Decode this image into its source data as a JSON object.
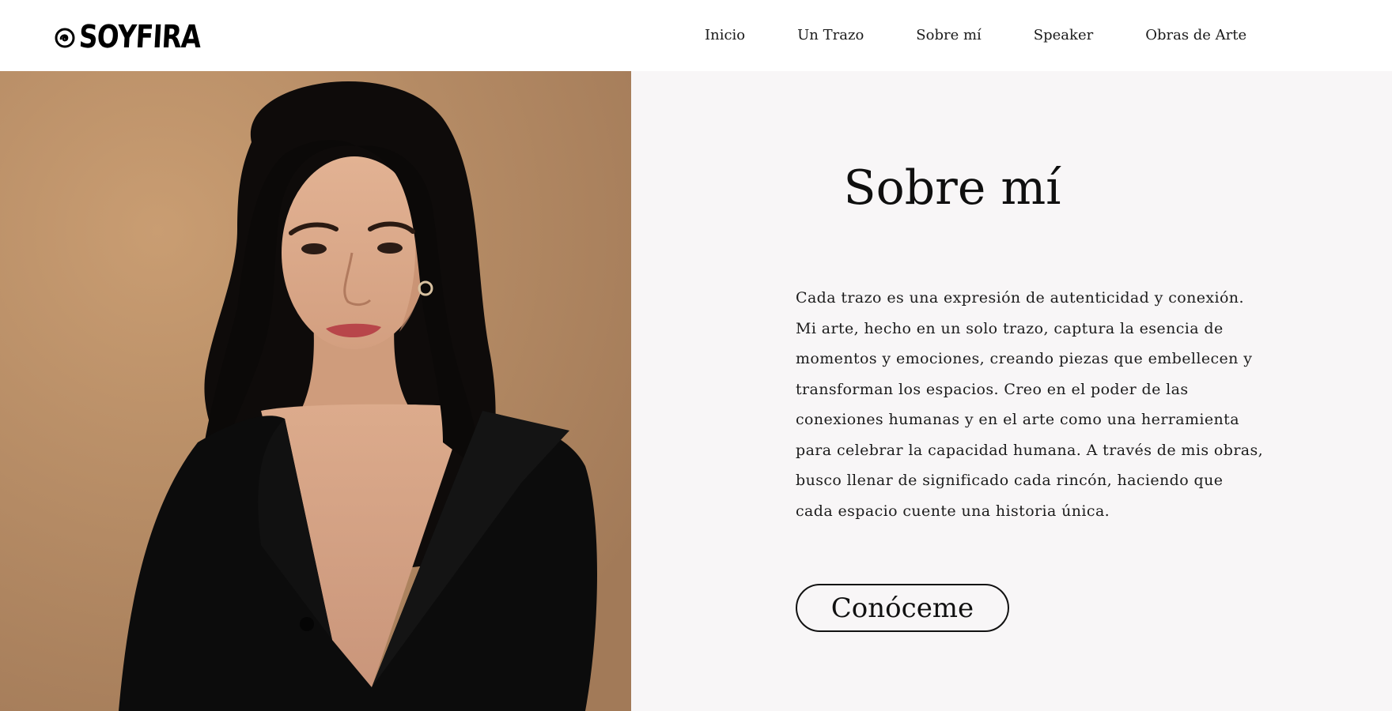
{
  "header": {
    "logo_text": "SOYFIRA",
    "logo_icon": "swirl-at-icon",
    "nav": [
      {
        "label": "Inicio"
      },
      {
        "label": "Un Trazo"
      },
      {
        "label": "Sobre mí"
      },
      {
        "label": "Speaker"
      },
      {
        "label": "Obras de Arte"
      }
    ]
  },
  "photo": {
    "alt": "portrait photo"
  },
  "about": {
    "title": "Sobre mí",
    "paragraph_lines": [
      "Cada trazo es una expresión de autenticidad y conexión.",
      "Mi arte, hecho en un solo trazo, captura la esencia de",
      "momentos y emociones, creando piezas que embellecen y",
      "transforman los espacios. Creo en el poder de las",
      "conexiones humanas y en el arte como una herramienta",
      "para celebrar la capacidad humana. A través de mis obras,",
      "busco llenar de significado cada rincón, haciendo que",
      "cada espacio cuente una historia única."
    ],
    "cta_label": "Conóceme"
  },
  "colors": {
    "background": "#ffffff",
    "about_background": "#f8f6f7",
    "photo_backdrop": "#b88e68",
    "text": "#111111"
  }
}
